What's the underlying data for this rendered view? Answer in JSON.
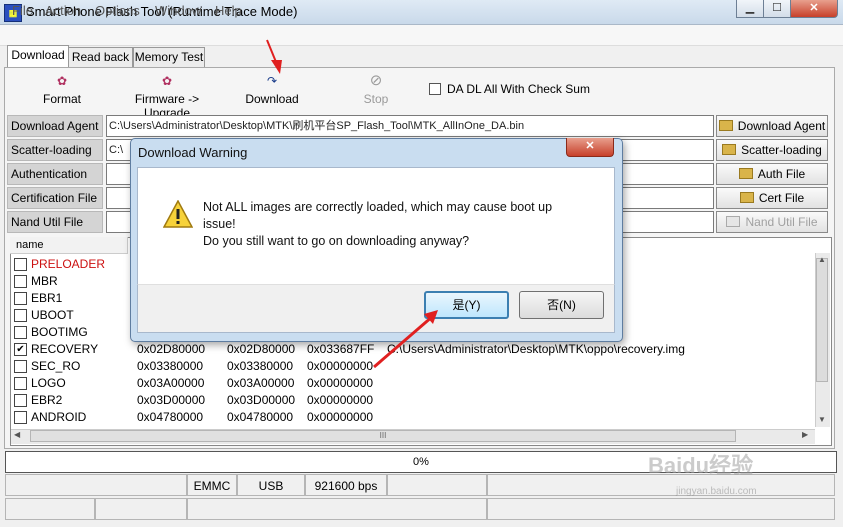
{
  "window": {
    "title": "Smart Phone Flash Tool (Runtime Trace Mode)",
    "icon": "mtk-app-icon"
  },
  "menu": [
    "File",
    "Action",
    "Options",
    "Window",
    "Help"
  ],
  "tabs": [
    "Download",
    "Read back",
    "Memory Test"
  ],
  "toolbar": {
    "format": "Format",
    "firmware_upgrade": "Firmware -> Upgrade",
    "download": "Download",
    "stop": "Stop",
    "checksum_label": "DA DL All With Check Sum"
  },
  "files": {
    "download_agent": {
      "label": "Download Agent",
      "value": "C:\\Users\\Administrator\\Desktop\\MTK\\刷机平台SP_Flash_Tool\\MTK_AllInOne_DA.bin",
      "button": "Download Agent"
    },
    "scatter_loading": {
      "label": "Scatter-loading File",
      "value": "C:\\",
      "button": "Scatter-loading"
    },
    "authentication": {
      "label": "Authentication File",
      "value": "",
      "button": "Auth File"
    },
    "certification": {
      "label": "Certification File",
      "value": "",
      "button": "Cert File"
    },
    "nand_util": {
      "label": "Nand Util File",
      "value": "",
      "button": "Nand Util File"
    }
  },
  "list": {
    "header_name": "name",
    "rows": [
      {
        "name": "PRELOADER",
        "checked": false,
        "red": true,
        "c2": "",
        "c3": "",
        "c4": "",
        "c5": ""
      },
      {
        "name": "MBR",
        "checked": false,
        "red": false,
        "c2": "",
        "c3": "",
        "c4": "",
        "c5": ""
      },
      {
        "name": "EBR1",
        "checked": false,
        "red": false,
        "c2": "",
        "c3": "",
        "c4": "",
        "c5": ""
      },
      {
        "name": "UBOOT",
        "checked": false,
        "red": false,
        "c2": "",
        "c3": "",
        "c4": "",
        "c5": ""
      },
      {
        "name": "BOOTIMG",
        "checked": false,
        "red": false,
        "c2": "",
        "c3": "",
        "c4": "",
        "c5": ""
      },
      {
        "name": "RECOVERY",
        "checked": true,
        "red": false,
        "c2": "0x02D80000",
        "c3": "0x02D80000",
        "c4": "0x033687FF",
        "c5": "C:\\Users\\Administrator\\Desktop\\MTK\\oppo\\recovery.img"
      },
      {
        "name": "SEC_RO",
        "checked": false,
        "red": false,
        "c2": "0x03380000",
        "c3": "0x03380000",
        "c4": "0x00000000",
        "c5": ""
      },
      {
        "name": "LOGO",
        "checked": false,
        "red": false,
        "c2": "0x03A00000",
        "c3": "0x03A00000",
        "c4": "0x00000000",
        "c5": ""
      },
      {
        "name": "EBR2",
        "checked": false,
        "red": false,
        "c2": "0x03D00000",
        "c3": "0x03D00000",
        "c4": "0x00000000",
        "c5": ""
      },
      {
        "name": "ANDROID",
        "checked": false,
        "red": false,
        "c2": "0x04780000",
        "c3": "0x04780000",
        "c4": "0x00000000",
        "c5": ""
      }
    ],
    "hscroll_grip": "III"
  },
  "progress": {
    "value": 0,
    "text": "0%"
  },
  "status": {
    "storage": "EMMC",
    "port": "USB",
    "baud": "921600 bps"
  },
  "dialog": {
    "title": "Download Warning",
    "line1": "Not ALL images are correctly loaded, which may cause boot up",
    "line2": "issue!",
    "line3": "Do you still want to go on downloading anyway?",
    "yes": "是(Y)",
    "no": "否(N)",
    "icon": "warning-icon"
  },
  "watermark": {
    "main": "Baidu经验",
    "sub": "jingyan.baidu.com"
  },
  "colors": {
    "dialog_frame": "#c9ddf0",
    "annotation_arrow": "#e02020",
    "preloader_text": "#cc1111"
  }
}
